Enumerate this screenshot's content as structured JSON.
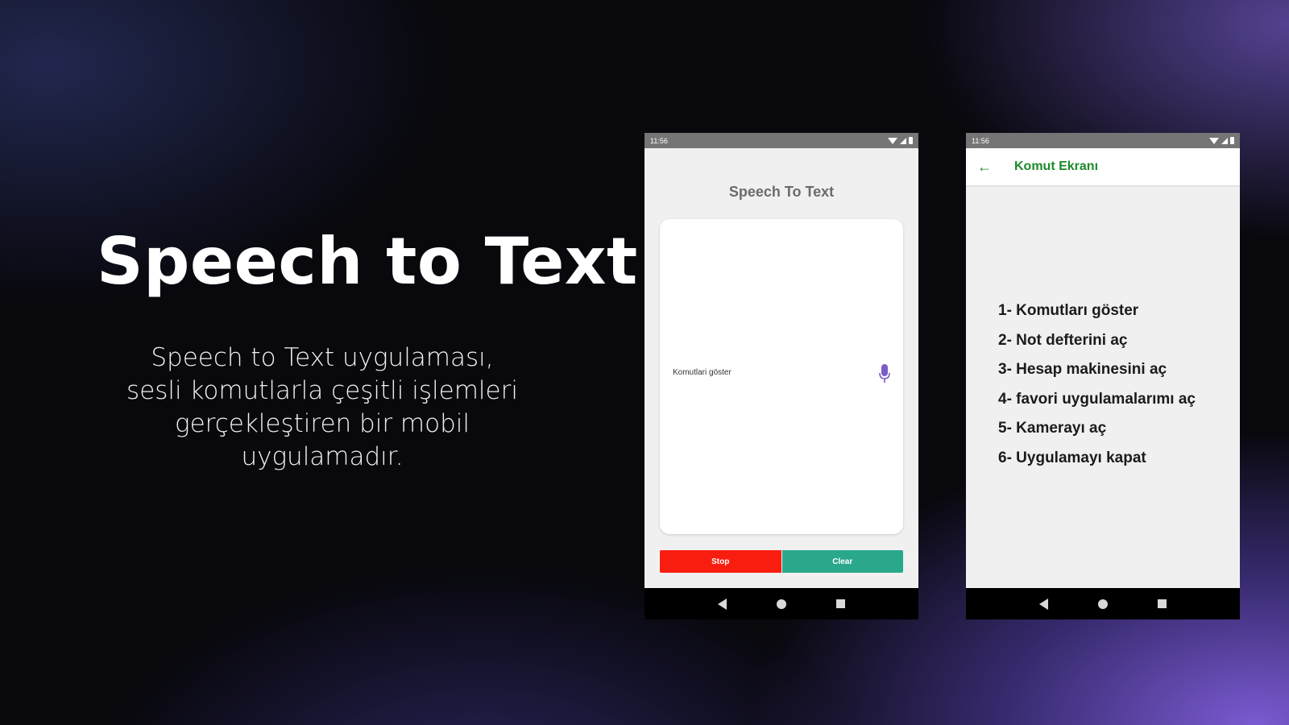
{
  "hero": {
    "title": "Speech to Text",
    "description": "Speech to Text uygulaması, sesli komutlarla çeşitli işlemleri gerçekleştiren bir mobil uygulamadır."
  },
  "phone_main": {
    "status_time": "11:56",
    "app_title": "Speech To Text",
    "recognized_text": "Komutlari göster",
    "stop_label": "Stop",
    "clear_label": "Clear",
    "colors": {
      "stop": "#f91d0f",
      "clear": "#2aa88c",
      "mic": "#7b5cc7"
    },
    "icons": [
      "wifi-icon",
      "signal-icon",
      "battery-icon",
      "microphone-icon",
      "back-nav-icon",
      "home-nav-icon",
      "recents-nav-icon"
    ]
  },
  "phone_commands": {
    "status_time": "11:56",
    "toolbar_title": "Komut Ekranı",
    "accent": "#1d8a2a",
    "commands": [
      "1- Komutları göster",
      "2- Not defterini aç",
      "3- Hesap makinesini aç",
      "4- favori uygulamalarımı aç",
      "5- Kamerayı aç",
      "6- Uygulamayı kapat"
    ],
    "icons": [
      "back-arrow-icon",
      "wifi-icon",
      "signal-icon",
      "battery-icon",
      "back-nav-icon",
      "home-nav-icon",
      "recents-nav-icon"
    ]
  }
}
